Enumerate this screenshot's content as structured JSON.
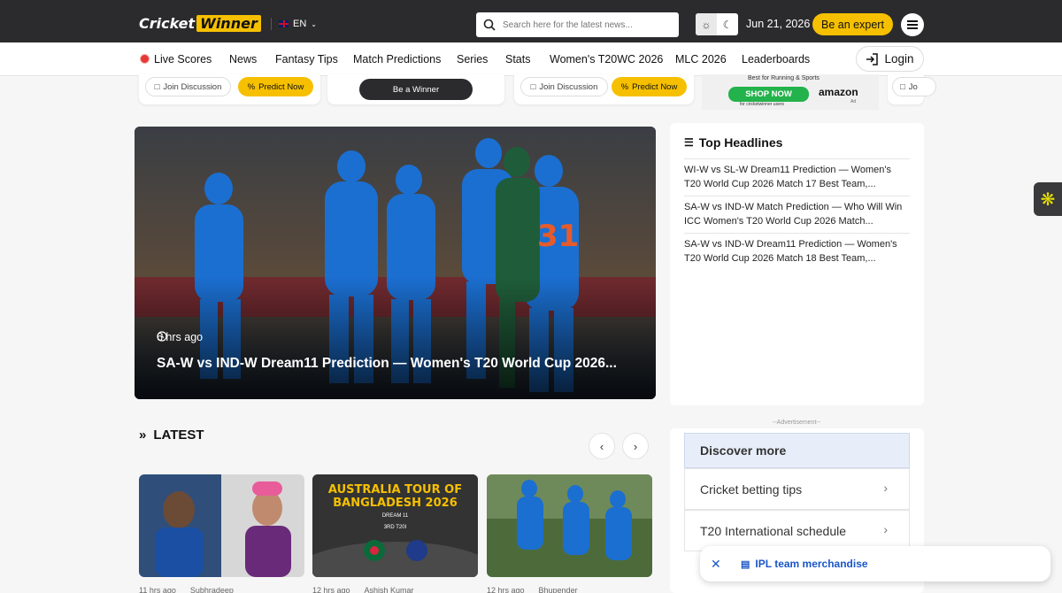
{
  "header": {
    "logo_part1": "Cricket",
    "logo_part2": "Winner",
    "language": "EN",
    "search_placeholder": "Search here for the latest news...",
    "date": "Jun 21, 2026",
    "expert_label": "Be an expert"
  },
  "nav": {
    "items": [
      "Live Scores",
      "News",
      "Fantasy Tips",
      "Match Predictions",
      "Series",
      "Stats",
      "Women's T20WC 2026",
      "MLC 2026",
      "Leaderboards"
    ],
    "login_label": "Login"
  },
  "strip": {
    "join_discussion": "Join Discussion",
    "predict_now": "Predict Now",
    "be_a_winner": "Be a Winner",
    "ad_tagline": "Best for Running & Sports",
    "ad_cta": "SHOP NOW",
    "ad_sub": "for cricketwinner users",
    "ad_brand": "amazon",
    "ad_badge": "Ad",
    "cut_pill": "Jo"
  },
  "hero": {
    "time": "6 hrs ago",
    "title": "SA-W vs IND-W Dream11 Prediction — Women's T20 World Cup 2026..."
  },
  "headlines": {
    "title": "Top Headlines",
    "items": [
      "WI-W vs SL-W Dream11 Prediction — Women's T20 World Cup 2026 Match 17 Best Team,...",
      "SA-W vs IND-W Match Prediction — Who Will Win ICC Women's T20 World Cup 2026 Match...",
      "SA-W vs IND-W Dream11 Prediction — Women's T20 World Cup 2026 Match 18 Best Team,..."
    ]
  },
  "latest": {
    "title": "LATEST",
    "thumb2_title": "AUSTRALIA TOUR OF BANGLADESH 2026",
    "thumb2_sub": "DREAM 11",
    "thumb2_match": "3RD T20I",
    "articles": [
      {
        "time": "11 hrs ago",
        "author": "Subhradeep"
      },
      {
        "time": "12 hrs ago",
        "author": "Ashish Kumar"
      },
      {
        "time": "12 hrs ago",
        "author": "Bhupender"
      }
    ]
  },
  "sidebar_ad": {
    "label": "--Advertisement--",
    "heading": "Discover more",
    "rows": [
      "Cricket betting tips",
      "T20 International schedule"
    ],
    "sticky": "IPL team merchandise"
  },
  "colors": {
    "accent": "#f6c000",
    "topbar": "#2b2b2d",
    "link": "#1a56c8"
  }
}
